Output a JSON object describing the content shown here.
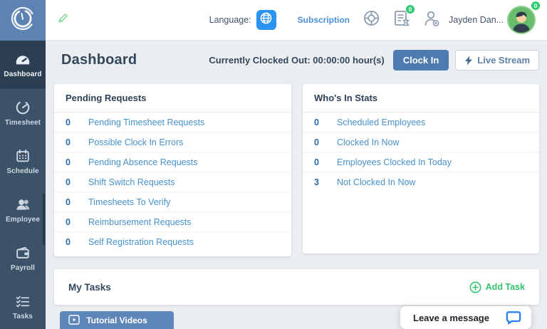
{
  "colors": {
    "sidebar": "#3c5269",
    "sidebar_active": "#2c3f52",
    "logo_bg": "#5d83b4",
    "accent_blue": "#4d7bb0",
    "link_blue": "#4792cc",
    "count_blue": "#2e6da4",
    "green": "#2ecc71",
    "globe_blue": "#2b93f2",
    "chat_blue": "#2f80ed"
  },
  "header": {
    "language_label": "Language:",
    "subscription_label": "Subscription",
    "notification_badge": "0",
    "user_name": "Jayden Dan...",
    "avatar_badge": "0"
  },
  "titlebar": {
    "title": "Dashboard",
    "clock_status": "Currently Clocked Out: 00:00:00 hour(s)",
    "clock_in_button": "Clock In",
    "live_stream_button": "Live Stream"
  },
  "sidebar": {
    "items": [
      {
        "label": "Dashboard",
        "icon": "gauge-icon",
        "active": true
      },
      {
        "label": "Timesheet",
        "icon": "clock-icon",
        "active": false
      },
      {
        "label": "Schedule",
        "icon": "calendar-icon",
        "active": false
      },
      {
        "label": "Employee",
        "icon": "people-icon",
        "active": false
      },
      {
        "label": "Payroll",
        "icon": "wallet-icon",
        "active": false
      },
      {
        "label": "Tasks",
        "icon": "checklist-icon",
        "active": false
      }
    ]
  },
  "pending_requests": {
    "title": "Pending Requests",
    "items": [
      {
        "count": "0",
        "label": "Pending Timesheet Requests"
      },
      {
        "count": "0",
        "label": "Possible Clock In Errors"
      },
      {
        "count": "0",
        "label": "Pending Absence Requests"
      },
      {
        "count": "0",
        "label": "Shift Switch Requests"
      },
      {
        "count": "0",
        "label": "Timesheets To Verify"
      },
      {
        "count": "0",
        "label": "Reimbursement Requests"
      },
      {
        "count": "0",
        "label": "Self Registration Requests"
      }
    ]
  },
  "whos_in_stats": {
    "title": "Who's In Stats",
    "items": [
      {
        "count": "0",
        "label": "Scheduled Employees"
      },
      {
        "count": "0",
        "label": "Clocked In Now"
      },
      {
        "count": "0",
        "label": "Employees Clocked In Today"
      },
      {
        "count": "3",
        "label": "Not Clocked In Now"
      }
    ]
  },
  "my_tasks": {
    "title": "My Tasks",
    "add_task_button": "Add Task"
  },
  "tutorial_videos_button": "Tutorial Videos",
  "chat_widget": {
    "message": "Leave a message"
  }
}
